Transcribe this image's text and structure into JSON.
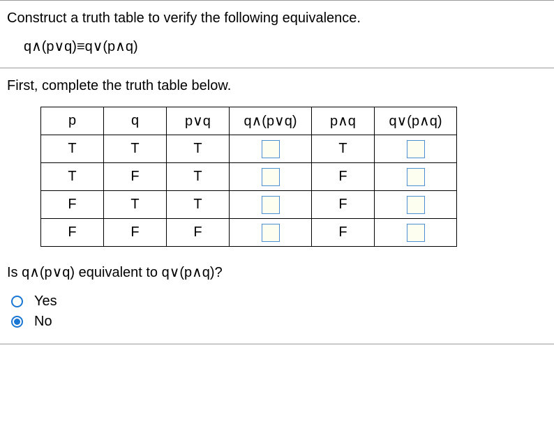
{
  "prompt": "Construct a truth table to verify the following equivalence.",
  "expression": "q∧(p∨q)≡q∨(p∧q)",
  "instruction": "First, complete the truth table below.",
  "table": {
    "headers": [
      "p",
      "q",
      "p∨q",
      "q∧(p∨q)",
      "p∧q",
      "q∨(p∧q)"
    ],
    "rows": [
      {
        "p": "T",
        "q": "T",
        "pvq": "T",
        "qapvq": "",
        "paq": "T",
        "qvpaq": ""
      },
      {
        "p": "T",
        "q": "F",
        "pvq": "T",
        "qapvq": "",
        "paq": "F",
        "qvpaq": ""
      },
      {
        "p": "F",
        "q": "T",
        "pvq": "T",
        "qapvq": "",
        "paq": "F",
        "qvpaq": ""
      },
      {
        "p": "F",
        "q": "F",
        "pvq": "F",
        "qapvq": "",
        "paq": "F",
        "qvpaq": ""
      }
    ]
  },
  "question": "Is q∧(p∨q) equivalent to q∨(p∧q)?",
  "options": {
    "yes": {
      "label": "Yes",
      "selected": false
    },
    "no": {
      "label": "No",
      "selected": true
    }
  }
}
